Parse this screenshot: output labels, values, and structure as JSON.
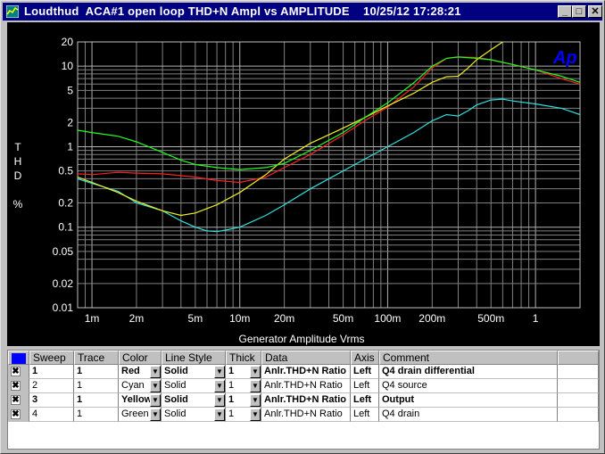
{
  "window": {
    "title": "Loudthud  ACA#1 open loop THD+N Ampl vs AMPLITUDE    10/25/12 17:28:21",
    "min_glyph": "_",
    "max_glyph": "□",
    "close_glyph": "✕"
  },
  "chart_data": {
    "type": "line",
    "xlabel": "Generator Amplitude Vrms",
    "ylabel": "THD %",
    "ylabel_chars": [
      "T",
      "H",
      "D",
      "",
      "%"
    ],
    "x_scale": "log",
    "y_scale": "log",
    "xlim": [
      0.0008,
      2
    ],
    "ylim": [
      0.01,
      20
    ],
    "grid": true,
    "x_ticks": [
      {
        "v": 0.001,
        "label": "1m"
      },
      {
        "v": 0.002,
        "label": "2m"
      },
      {
        "v": 0.005,
        "label": "5m"
      },
      {
        "v": 0.01,
        "label": "10m"
      },
      {
        "v": 0.02,
        "label": "20m"
      },
      {
        "v": 0.05,
        "label": "50m"
      },
      {
        "v": 0.1,
        "label": "100m"
      },
      {
        "v": 0.2,
        "label": "200m"
      },
      {
        "v": 0.5,
        "label": "500m"
      },
      {
        "v": 1,
        "label": "1"
      }
    ],
    "y_ticks": [
      {
        "v": 20,
        "label": "20"
      },
      {
        "v": 10,
        "label": "10"
      },
      {
        "v": 5,
        "label": "5"
      },
      {
        "v": 2,
        "label": "2"
      },
      {
        "v": 1,
        "label": "1"
      },
      {
        "v": 0.5,
        "label": "0.5"
      },
      {
        "v": 0.2,
        "label": "0.2"
      },
      {
        "v": 0.1,
        "label": "0.1"
      },
      {
        "v": 0.05,
        "label": "0.05"
      },
      {
        "v": 0.02,
        "label": "0.02"
      },
      {
        "v": 0.01,
        "label": "0.01"
      }
    ],
    "logo": "Ap",
    "series": [
      {
        "name": "Q4 drain differential",
        "color": "#ff2020",
        "x": [
          0.0008,
          0.001,
          0.0015,
          0.002,
          0.003,
          0.005,
          0.007,
          0.01,
          0.015,
          0.02,
          0.03,
          0.05,
          0.07,
          0.1,
          0.15,
          0.2,
          0.25,
          0.3,
          0.4,
          0.5,
          0.7,
          1,
          1.5,
          2
        ],
        "y": [
          0.46,
          0.45,
          0.48,
          0.47,
          0.46,
          0.42,
          0.38,
          0.36,
          0.42,
          0.55,
          0.8,
          1.4,
          2.1,
          3.1,
          5.5,
          9.5,
          12.5,
          13,
          12.8,
          12,
          10.5,
          9,
          7,
          6
        ]
      },
      {
        "name": "Q4 source",
        "color": "#30e0e0",
        "x": [
          0.0008,
          0.001,
          0.0015,
          0.002,
          0.003,
          0.004,
          0.005,
          0.006,
          0.007,
          0.008,
          0.01,
          0.015,
          0.02,
          0.03,
          0.05,
          0.07,
          0.1,
          0.15,
          0.2,
          0.25,
          0.3,
          0.35,
          0.4,
          0.5,
          0.6,
          0.7,
          1,
          1.5,
          2
        ],
        "y": [
          0.4,
          0.35,
          0.28,
          0.2,
          0.16,
          0.12,
          0.1,
          0.09,
          0.088,
          0.092,
          0.1,
          0.14,
          0.19,
          0.3,
          0.5,
          0.7,
          1,
          1.5,
          2.1,
          2.5,
          2.4,
          2.8,
          3.3,
          3.8,
          3.9,
          3.7,
          3.4,
          3,
          2.5
        ]
      },
      {
        "name": "Output",
        "color": "#f0f020",
        "x": [
          0.0008,
          0.001,
          0.0015,
          0.002,
          0.003,
          0.004,
          0.005,
          0.007,
          0.01,
          0.015,
          0.02,
          0.03,
          0.05,
          0.07,
          0.1,
          0.15,
          0.2,
          0.25,
          0.3,
          0.35,
          0.4,
          0.5,
          0.6
        ],
        "y": [
          0.42,
          0.36,
          0.27,
          0.21,
          0.16,
          0.14,
          0.15,
          0.19,
          0.27,
          0.45,
          0.7,
          1.1,
          1.7,
          2.3,
          3.2,
          4.6,
          6.3,
          7.4,
          7.5,
          9.5,
          12,
          16,
          20
        ]
      },
      {
        "name": "Q4 drain",
        "color": "#20ff20",
        "x": [
          0.0008,
          0.001,
          0.0015,
          0.002,
          0.003,
          0.004,
          0.005,
          0.007,
          0.01,
          0.015,
          0.02,
          0.03,
          0.05,
          0.07,
          0.1,
          0.15,
          0.2,
          0.25,
          0.3,
          0.4,
          0.5,
          0.7,
          1,
          1.5,
          2
        ],
        "y": [
          1.6,
          1.5,
          1.35,
          1.15,
          0.85,
          0.68,
          0.6,
          0.55,
          0.52,
          0.55,
          0.62,
          0.9,
          1.5,
          2.3,
          3.5,
          6.2,
          10,
          12.5,
          13,
          12.5,
          12,
          10.5,
          9,
          7.5,
          6.3
        ]
      }
    ]
  },
  "table": {
    "headers": [
      "Sweep",
      "Trace",
      "Color",
      "Line Style",
      "Thick",
      "Data",
      "Axis",
      "Comment"
    ],
    "rows": [
      {
        "sweep": "1",
        "trace": "1",
        "color": "Red",
        "style": "Solid",
        "thick": "1",
        "data": "Anlr.THD+N Ratio",
        "axis": "Left",
        "comment": "Q4 drain differential",
        "bold": true
      },
      {
        "sweep": "2",
        "trace": "1",
        "color": "Cyan",
        "style": "Solid",
        "thick": "1",
        "data": "Anlr.THD+N Ratio",
        "axis": "Left",
        "comment": "Q4 source",
        "bold": false
      },
      {
        "sweep": "3",
        "trace": "1",
        "color": "Yellow",
        "style": "Solid",
        "thick": "1",
        "data": "Anlr.THD+N Ratio",
        "axis": "Left",
        "comment": "Output",
        "bold": true
      },
      {
        "sweep": "4",
        "trace": "1",
        "color": "Green",
        "style": "Solid",
        "thick": "1",
        "data": "Anlr.THD+N Ratio",
        "axis": "Left",
        "comment": "Q4 drain",
        "bold": false
      }
    ],
    "check_glyph": "✖",
    "dropdown_glyph": "▼"
  }
}
